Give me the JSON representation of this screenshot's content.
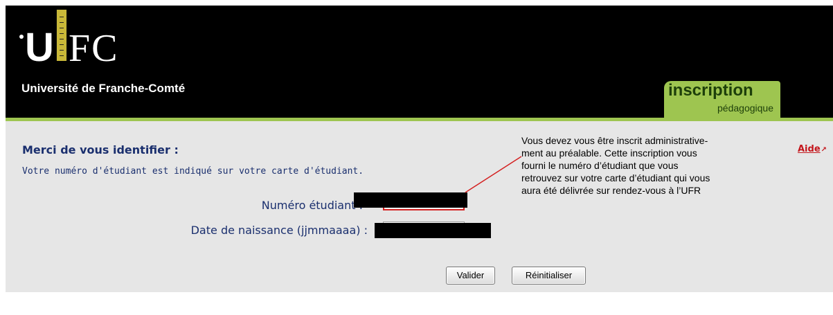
{
  "header": {
    "logo_left": "U",
    "logo_right": "FC",
    "university_name": "Université de Franche-Comté",
    "tab_line1": "inscription",
    "tab_line2": "pédagogique"
  },
  "form": {
    "title": "Merci de vous identifier :",
    "hint": "Votre numéro d'étudiant est indiqué sur votre carte d'étudiant.",
    "student_number_label": "Numéro étudiant :",
    "student_number_value": "",
    "birth_date_label": "Date de naissance (jjmmaaaa) :",
    "birth_date_value": "",
    "validate_label": "Valider",
    "reset_label": "Réinitialiser"
  },
  "help": {
    "label": "Aide",
    "arrow_icon": "external-arrow-icon"
  },
  "annotation": {
    "lines": [
      "Vous devez vous être inscrit administrative-",
      "ment au préalable. Cette inscription vous",
      "fourni le numéro d’étudiant que vous",
      "retrouvez sur votre carte d’étudiant qui vous",
      "aura été délivrée sur rendez-vous à l’UFR"
    ]
  },
  "colors": {
    "header_bg": "#000000",
    "accent_green": "#9ec550",
    "panel_bg": "#e6e6e6",
    "text_blue": "#1a2f6e",
    "link_red": "#c4161c",
    "callout_red": "#d42020"
  }
}
